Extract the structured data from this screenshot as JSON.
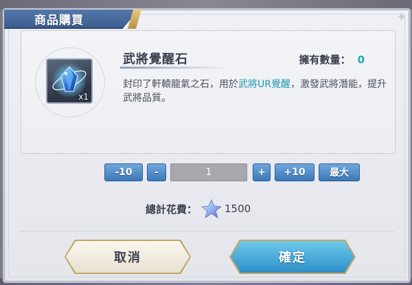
{
  "dialog": {
    "title": "商品購買"
  },
  "item": {
    "name": "武將覺醒石",
    "icon": "awakening-crystal-icon",
    "stack_label": "x1",
    "owned_label": "擁有數量：",
    "owned_value": "0",
    "desc_part1": "封印了軒轅龍氣之石，用於",
    "desc_highlight": "武將UR覺醒",
    "desc_part2": "，激發武將潛能，提升武將品質。"
  },
  "quantity": {
    "minus10_label": "-10",
    "minus1_label": "-",
    "value": "1",
    "plus1_label": "+",
    "plus10_label": "+10",
    "max_label": "最大"
  },
  "total": {
    "label": "總計花費：",
    "currency_icon": "star-crystal-icon",
    "amount": "1500"
  },
  "actions": {
    "cancel_label": "取消",
    "confirm_label": "確定"
  },
  "colors": {
    "accent_blue": "#3d78b8",
    "highlight_teal": "#1d9aad",
    "confirm_blue": "#2d8fc8",
    "frame_gold": "#c4a763"
  }
}
